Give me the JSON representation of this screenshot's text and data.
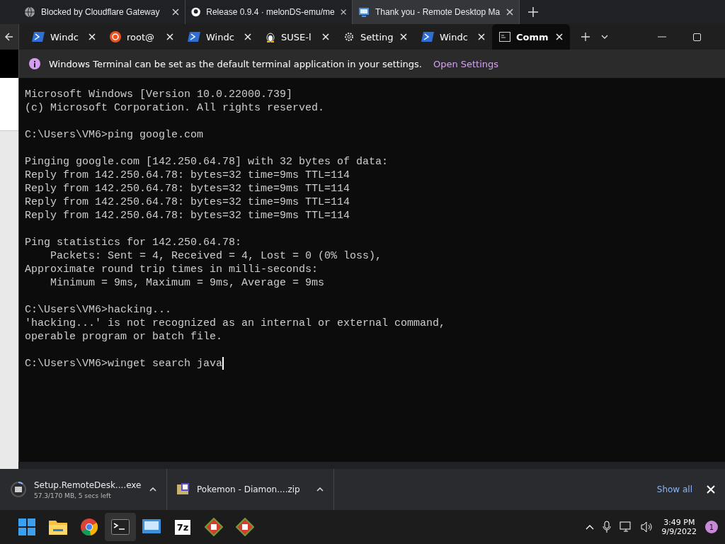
{
  "browser": {
    "tabs": [
      {
        "title": "Blocked by Cloudflare Gateway",
        "kind": "globe",
        "selected": false
      },
      {
        "title": "Release 0.9.4 · melonDS-emu/me",
        "kind": "github",
        "selected": false
      },
      {
        "title": "Thank you - Remote Desktop Ma",
        "kind": "remote",
        "selected": true
      }
    ]
  },
  "terminal": {
    "tabs": [
      {
        "label": "Windc",
        "kind": "powershell",
        "selected": false
      },
      {
        "label": "root@",
        "kind": "ubuntu",
        "selected": false
      },
      {
        "label": "Windc",
        "kind": "powershell",
        "selected": false
      },
      {
        "label": "SUSE-l",
        "kind": "linux",
        "selected": false
      },
      {
        "label": "Setting",
        "kind": "settings",
        "selected": false
      },
      {
        "label": "Windc",
        "kind": "powershell",
        "selected": false
      },
      {
        "label": "Comm",
        "kind": "cmd",
        "selected": true
      }
    ],
    "infobar": {
      "message": "Windows Terminal can be set as the default terminal application in your settings.",
      "link": "Open Settings"
    },
    "blocks": [
      [
        "Microsoft Windows [Version 10.0.22000.739]",
        "(c) Microsoft Corporation. All rights reserved."
      ],
      [
        "C:\\Users\\VM6>ping google.com"
      ],
      [
        "Pinging google.com [142.250.64.78] with 32 bytes of data:",
        "Reply from 142.250.64.78: bytes=32 time=9ms TTL=114",
        "Reply from 142.250.64.78: bytes=32 time=9ms TTL=114",
        "Reply from 142.250.64.78: bytes=32 time=9ms TTL=114",
        "Reply from 142.250.64.78: bytes=32 time=9ms TTL=114"
      ],
      [
        "Ping statistics for 142.250.64.78:",
        "    Packets: Sent = 4, Received = 4, Lost = 0 (0% loss),",
        "Approximate round trip times in milli-seconds:",
        "    Minimum = 9ms, Maximum = 9ms, Average = 9ms"
      ],
      [
        "C:\\Users\\VM6>hacking...",
        "'hacking...' is not recognized as an internal or external command,",
        "operable program or batch file."
      ],
      [
        "C:\\Users\\VM6>winget search java"
      ]
    ]
  },
  "downloads": {
    "items": [
      {
        "name": "Setup.RemoteDesk....exe",
        "detail": "57.3/170 MB, 5 secs left",
        "kind": "progress"
      },
      {
        "name": "Pokemon - Diamon....zip",
        "kind": "archive"
      }
    ],
    "show_all": "Show all"
  },
  "taskbar": {
    "apps": [
      {
        "kind": "start",
        "selected": false
      },
      {
        "kind": "folder",
        "selected": false
      },
      {
        "kind": "browser",
        "selected": false
      },
      {
        "kind": "terminal",
        "selected": true
      },
      {
        "kind": "remote",
        "selected": false
      },
      {
        "kind": "sevenzip",
        "label": "7z",
        "selected": false
      },
      {
        "kind": "game",
        "selected": false
      },
      {
        "kind": "game",
        "selected": false
      }
    ],
    "time": "3:49 PM",
    "date": "9/9/2022",
    "badge": "1"
  }
}
